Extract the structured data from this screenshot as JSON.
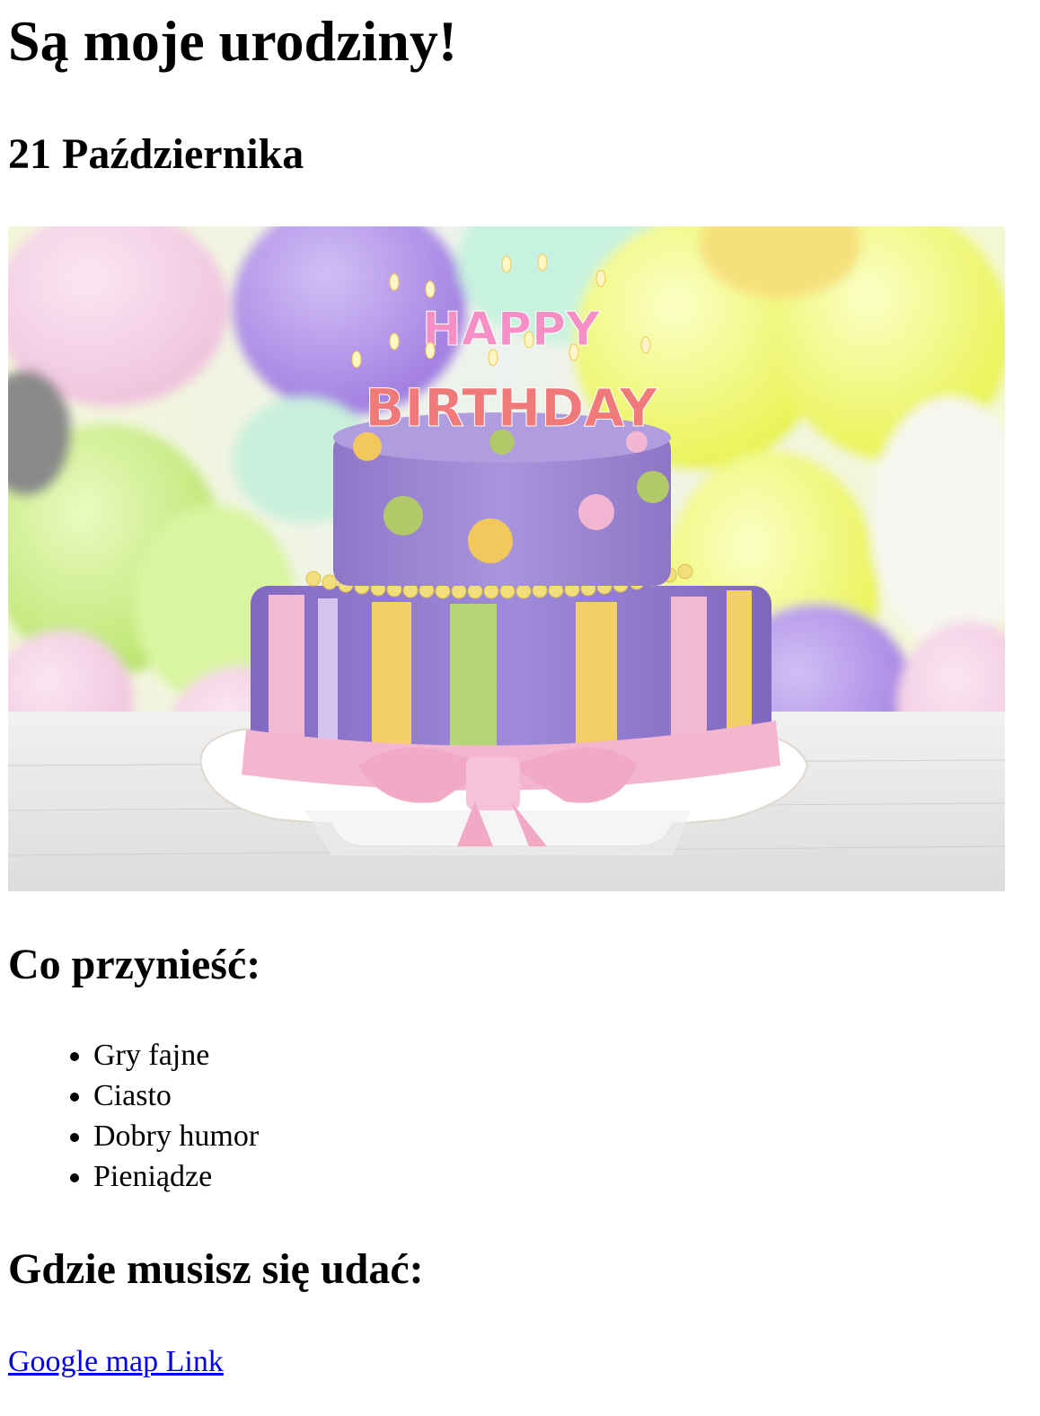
{
  "page": {
    "title": "Są moje urodziny!",
    "date": "21 Października",
    "photo": {
      "candle_text_line1": "HAPPY",
      "candle_text_line2": "BIRTHDAY"
    },
    "bring_heading": "Co przynieść:",
    "bring_items": [
      "Gry fajne",
      "Ciasto",
      "Dobry humor",
      "Pieniądze"
    ],
    "where_heading": "Gdzie musisz się udać:",
    "map_link": "Google map Link"
  },
  "colors": {
    "link": "#0000ee",
    "cake_purple": "#9d85d6",
    "ribbon_pink": "#f4b6cf",
    "stripe_yellow": "#f3cf6a",
    "stripe_green": "#b6d67a"
  }
}
